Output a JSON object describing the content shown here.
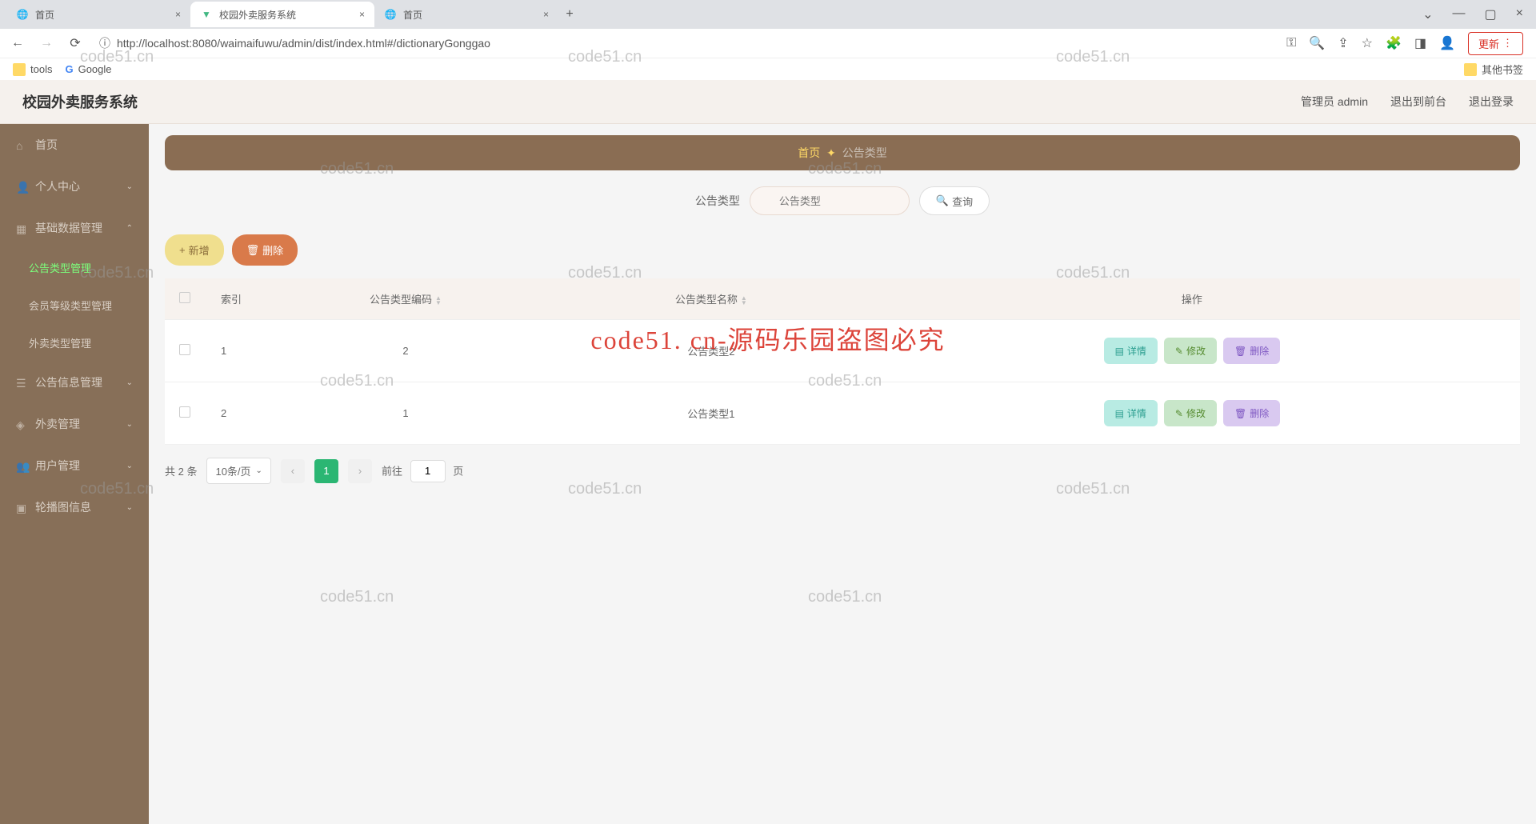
{
  "browser": {
    "tabs": [
      {
        "title": "首页",
        "active": false
      },
      {
        "title": "校园外卖服务系统",
        "active": true
      },
      {
        "title": "首页",
        "active": false
      }
    ],
    "url": "http://localhost:8080/waimaifuwu/admin/dist/index.html#/dictionaryGonggao",
    "update_btn": "更新",
    "bookmarks": [
      {
        "label": "tools"
      },
      {
        "label": "Google"
      }
    ],
    "other_bookmarks": "其他书签"
  },
  "header": {
    "app_title": "校园外卖服务系统",
    "user_label": "管理员 admin",
    "to_front": "退出到前台",
    "logout": "退出登录"
  },
  "sidebar": {
    "home": "首页",
    "personal": "个人中心",
    "base_data": "基础数据管理",
    "subs": {
      "gonggao": "公告类型管理",
      "huiyuan": "会员等级类型管理",
      "waimai_type": "外卖类型管理"
    },
    "gonggao_info": "公告信息管理",
    "waimai_mgmt": "外卖管理",
    "user_mgmt": "用户管理",
    "carousel": "轮播图信息"
  },
  "breadcrumb": {
    "home": "首页",
    "current": "公告类型"
  },
  "search": {
    "label": "公告类型",
    "placeholder": "公告类型",
    "query": "查询"
  },
  "actions": {
    "add": "新增",
    "delete": "删除"
  },
  "table": {
    "cols": {
      "index": "索引",
      "code": "公告类型编码",
      "name": "公告类型名称",
      "ops": "操作"
    },
    "rows": [
      {
        "index": "1",
        "code": "2",
        "name": "公告类型2"
      },
      {
        "index": "2",
        "code": "1",
        "name": "公告类型1"
      }
    ],
    "op_labels": {
      "detail": "详情",
      "edit": "修改",
      "delete": "删除"
    }
  },
  "pagination": {
    "total": "共 2 条",
    "page_size": "10条/页",
    "current": "1",
    "goto_prefix": "前往",
    "goto_suffix": "页",
    "goto_value": "1"
  },
  "watermark_text": "code51.cn",
  "watermark_big": "code51. cn-源码乐园盗图必究"
}
